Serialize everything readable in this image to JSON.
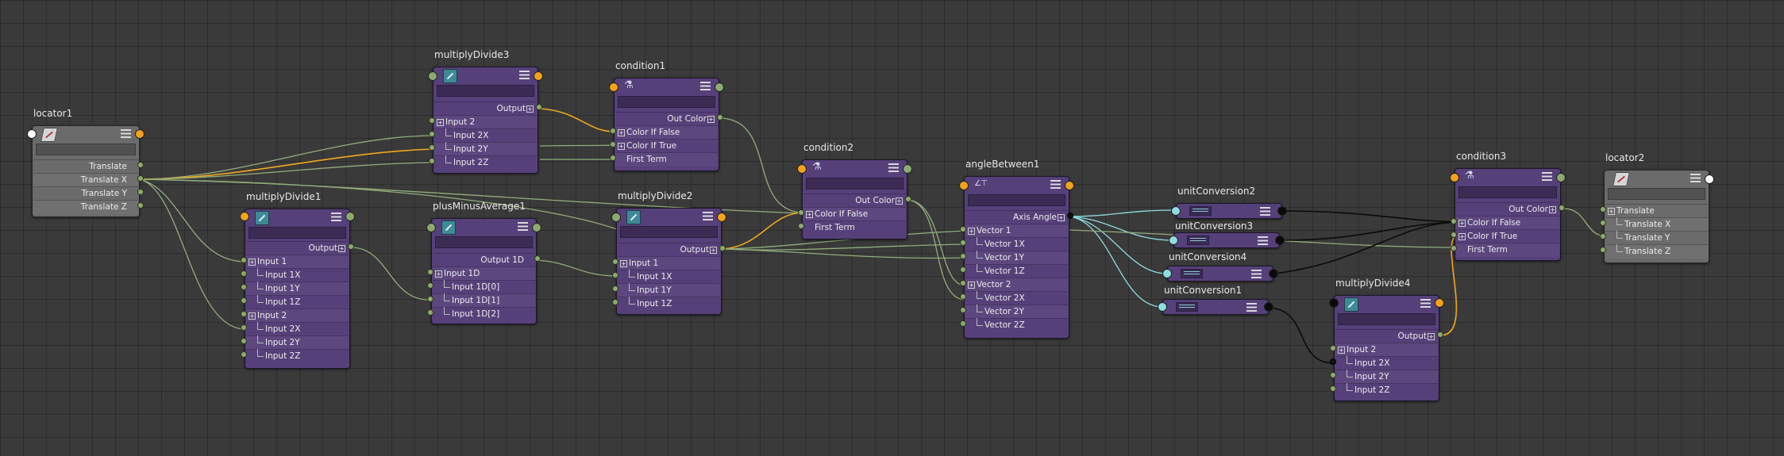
{
  "nodes": {
    "locator1": {
      "title": "locator1",
      "attrs": [
        "Translate",
        "Translate X",
        "Translate Y",
        "Translate Z"
      ]
    },
    "multiplyDivide1": {
      "title": "multiplyDivide1",
      "output": "Output",
      "attrs": [
        "Input 1",
        "Input 1X",
        "Input 1Y",
        "Input 1Z",
        "Input 2",
        "Input 2X",
        "Input 2Y",
        "Input 2Z"
      ]
    },
    "multiplyDivide3": {
      "title": "multiplyDivide3",
      "output": "Output",
      "attrs": [
        "Input 2",
        "Input 2X",
        "Input 2Y",
        "Input 2Z"
      ]
    },
    "plusMinusAverage1": {
      "title": "plusMinusAverage1",
      "output": "Output 1D",
      "attrs": [
        "Input 1D",
        "Input 1D[0]",
        "Input 1D[1]",
        "Input 1D[2]"
      ]
    },
    "condition1": {
      "title": "condition1",
      "output": "Out Color",
      "attrs": [
        "Color If False",
        "Color If True",
        "First Term"
      ]
    },
    "multiplyDivide2": {
      "title": "multiplyDivide2",
      "output": "Output",
      "attrs": [
        "Input 1",
        "Input 1X",
        "Input 1Y",
        "Input 1Z"
      ]
    },
    "condition2": {
      "title": "condition2",
      "output": "Out Color",
      "attrs": [
        "Color If False",
        "First Term"
      ]
    },
    "angleBetween1": {
      "title": "angleBetween1",
      "output": "Axis Angle",
      "attrs": [
        "Vector 1",
        "Vector 1X",
        "Vector 1Y",
        "Vector 1Z",
        "Vector 2",
        "Vector 2X",
        "Vector 2Y",
        "Vector 2Z"
      ]
    },
    "unitConversion2": {
      "title": "unitConversion2"
    },
    "unitConversion3": {
      "title": "unitConversion3"
    },
    "unitConversion4": {
      "title": "unitConversion4"
    },
    "unitConversion1": {
      "title": "unitConversion1"
    },
    "multiplyDivide4": {
      "title": "multiplyDivide4",
      "output": "Output",
      "attrs": [
        "Input 2",
        "Input 2X",
        "Input 2Y",
        "Input 2Z"
      ]
    },
    "condition3": {
      "title": "condition3",
      "output": "Out Color",
      "attrs": [
        "Color If False",
        "Color If True",
        "First Term"
      ]
    },
    "locator2": {
      "title": "locator2",
      "attrs": [
        "Translate",
        "Translate X",
        "Translate Y",
        "Translate Z"
      ]
    }
  },
  "colors": {
    "wire_green": "#93ad7b",
    "wire_orange": "#f2a81d",
    "wire_cyan": "#8fdce2",
    "wire_black": "#0a0a0a",
    "node_purple": "#56407a",
    "node_gray": "#6b6b6b"
  }
}
